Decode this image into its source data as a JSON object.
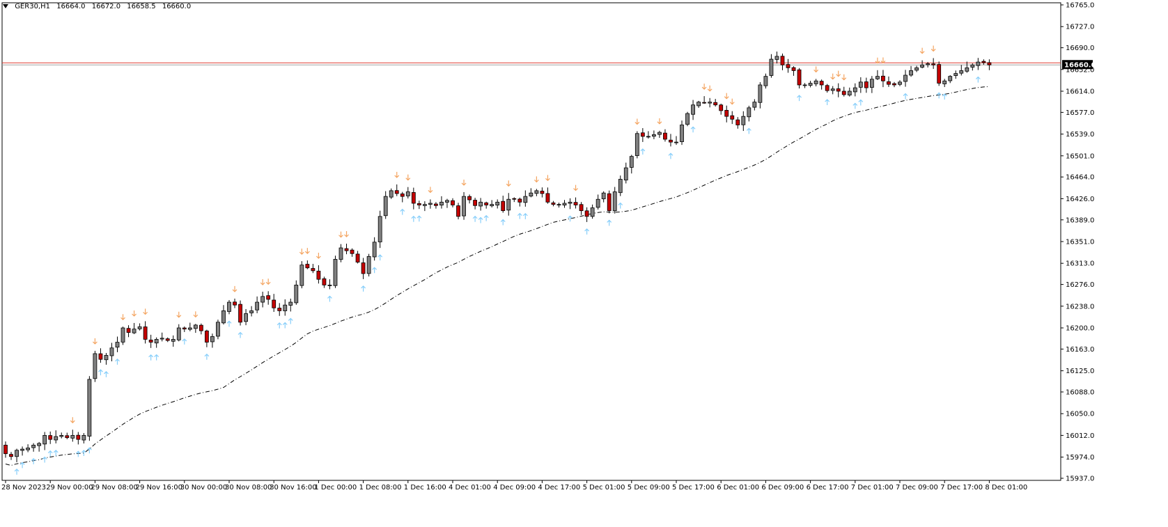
{
  "header": {
    "symbol": "GER30,H1",
    "open": "16664.0",
    "high": "16672.0",
    "low": "16658.5",
    "close": "16660.0"
  },
  "current_price_label": "16660.0",
  "colors": {
    "bull": "#808080",
    "bear": "#c40000",
    "wick": "#000000",
    "up_arrow": "#87cefa",
    "down_arrow": "#f4a460",
    "price_line": "#e03c31",
    "ma": "#000000"
  },
  "chart_data": {
    "type": "candlestick",
    "ylim": [
      15937,
      16765
    ],
    "y_ticks": [
      "16765.0",
      "16727.0",
      "16690.0",
      "16652.0",
      "16614.0",
      "16577.0",
      "16539.0",
      "16501.0",
      "16464.0",
      "16426.0",
      "16389.0",
      "16351.0",
      "16313.0",
      "16276.0",
      "16238.0",
      "16200.0",
      "16163.0",
      "16125.0",
      "16088.0",
      "16050.0",
      "16012.0",
      "15974.0",
      "15937.0"
    ],
    "x_labels": [
      {
        "i": 0,
        "label": "28 Nov 2023"
      },
      {
        "i": 8,
        "label": "29 Nov 00:00"
      },
      {
        "i": 16,
        "label": "29 Nov 08:00"
      },
      {
        "i": 24,
        "label": "29 Nov 16:00"
      },
      {
        "i": 32,
        "label": "30 Nov 00:00"
      },
      {
        "i": 40,
        "label": "30 Nov 08:00"
      },
      {
        "i": 48,
        "label": "30 Nov 16:00"
      },
      {
        "i": 56,
        "label": "1 Dec 00:00"
      },
      {
        "i": 64,
        "label": "1 Dec 08:00"
      },
      {
        "i": 72,
        "label": "1 Dec 16:00"
      },
      {
        "i": 80,
        "label": "4 Dec 01:00"
      },
      {
        "i": 88,
        "label": "4 Dec 09:00"
      },
      {
        "i": 96,
        "label": "4 Dec 17:00"
      },
      {
        "i": 104,
        "label": "5 Dec 01:00"
      },
      {
        "i": 112,
        "label": "5 Dec 09:00"
      },
      {
        "i": 120,
        "label": "5 Dec 17:00"
      },
      {
        "i": 128,
        "label": "6 Dec 01:00"
      },
      {
        "i": 136,
        "label": "6 Dec 09:00"
      },
      {
        "i": 144,
        "label": "6 Dec 17:00"
      },
      {
        "i": 152,
        "label": "7 Dec 01:00"
      },
      {
        "i": 160,
        "label": "7 Dec 09:00"
      },
      {
        "i": 168,
        "label": "7 Dec 17:00"
      },
      {
        "i": 176,
        "label": "8 Dec 01:00"
      }
    ],
    "close": [
      15980,
      15975,
      15986,
      15988,
      15990,
      15995,
      15998,
      16012,
      16005,
      16010,
      16012,
      16008,
      16012,
      16005,
      16012,
      16110,
      16155,
      16145,
      16152,
      16165,
      16175,
      16200,
      16192,
      16198,
      16202,
      16180,
      16175,
      16180,
      16182,
      16178,
      16180,
      16200,
      16198,
      16200,
      16205,
      16195,
      16175,
      16185,
      16210,
      16230,
      16245,
      16240,
      16210,
      16225,
      16230,
      16245,
      16255,
      16250,
      16235,
      16230,
      16240,
      16245,
      16275,
      16310,
      16305,
      16300,
      16285,
      16275,
      16275,
      16320,
      16340,
      16335,
      16330,
      16315,
      16295,
      16325,
      16350,
      16395,
      16430,
      16440,
      16435,
      16430,
      16438,
      16418,
      16415,
      16416,
      16418,
      16414,
      16420,
      16423,
      16415,
      16395,
      16430,
      16424,
      16414,
      16420,
      16415,
      16416,
      16420,
      16405,
      16425,
      16425,
      16420,
      16430,
      16436,
      16440,
      16435,
      16420,
      16416,
      16416,
      16418,
      16420,
      16415,
      16405,
      16395,
      16410,
      16425,
      16436,
      16405,
      16438,
      16460,
      16480,
      16500,
      16540,
      16535,
      16535,
      16538,
      16542,
      16530,
      16525,
      16525,
      16555,
      16575,
      16590,
      16595,
      16594,
      16595,
      16590,
      16580,
      16570,
      16565,
      16555,
      16570,
      16585,
      16595,
      16625,
      16640,
      16670,
      16675,
      16660,
      16655,
      16650,
      16625,
      16625,
      16628,
      16632,
      16625,
      16615,
      16618,
      16614,
      16608,
      16614,
      16620,
      16630,
      16620,
      16635,
      16640,
      16632,
      16626,
      16625,
      16630,
      16642,
      16650,
      16655,
      16660,
      16662,
      16660,
      16628,
      16632,
      16640,
      16645,
      16650,
      16655,
      16660,
      16665,
      16664,
      16660
    ],
    "ma_line": "dash-dot, below price"
  }
}
